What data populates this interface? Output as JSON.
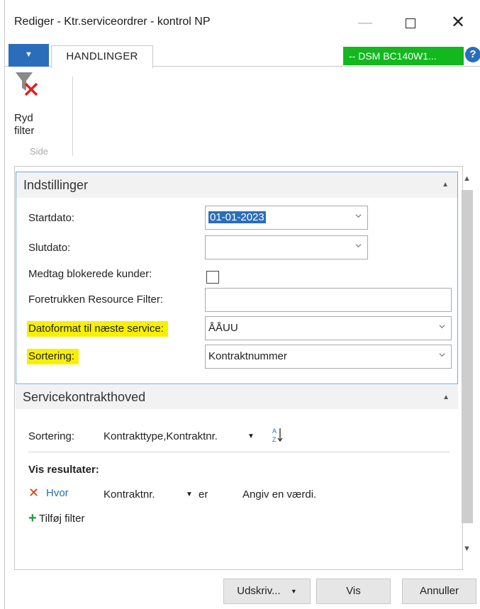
{
  "window": {
    "title": "Rediger - Ktr.serviceordrer - kontrol NP",
    "minimize_glyph": "—",
    "close_glyph": "✕"
  },
  "ribbon": {
    "menu_arrow": "▼",
    "tab_label": "HANDLINGER",
    "server_badge": "-- DSM BC140W1...",
    "help_glyph": "?",
    "clear_filter_line1": "Ryd",
    "clear_filter_line2": "filter",
    "group_label": "Side"
  },
  "scrollbar": {
    "up_glyph": "▲",
    "down_glyph": "▼"
  },
  "indstillinger": {
    "title": "Indstillinger",
    "collapse_glyph": "▲",
    "fields": {
      "startdato_label": "Startdato:",
      "startdato_value": "01-01-2023",
      "slutdato_label": "Slutdato:",
      "slutdato_value": "",
      "medtag_label": "Medtag blokerede kunder:",
      "medtag_checked": false,
      "resource_filter_label": "Foretrukken Resource Filter:",
      "resource_filter_value": "",
      "datoformat_label": "Datoformat til næste service:",
      "datoformat_value": "ÅÅUU",
      "sortering_label": "Sortering:",
      "sortering_value": "Kontraktnummer"
    }
  },
  "servicekontrakthoved": {
    "title": "Servicekontrakthoved",
    "collapse_glyph": "▲",
    "sort_label": "Sortering:",
    "sort_value": "Kontrakttype,Kontraktnr.",
    "dropdown_glyph": "▼",
    "results_label": "Vis resultater:",
    "remove_glyph": "✕",
    "where_label": "Hvor",
    "filter_field": "Kontraktnr.",
    "operator": "er",
    "placeholder": "Angiv en værdi.",
    "add_glyph": "+",
    "add_filter_label": "Tilføj filter"
  },
  "footer": {
    "print_label": "Udskriv...",
    "print_arrow": "▼",
    "preview_label": "Vis",
    "cancel_label": "Annuller"
  },
  "colors": {
    "accent_blue": "#2a6ebb",
    "badge_green": "#12b81e",
    "highlight_yellow": "#f7f000",
    "delete_red": "#d83b01"
  }
}
